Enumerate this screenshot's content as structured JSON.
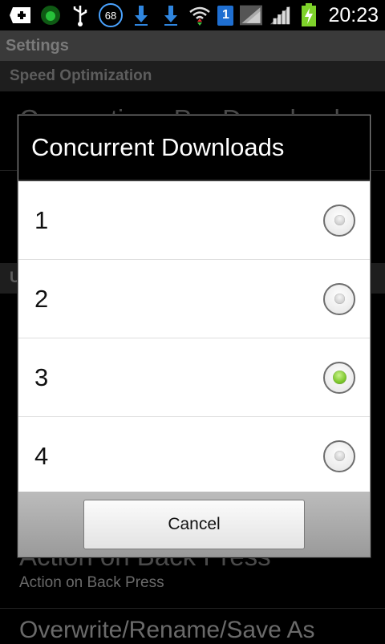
{
  "status_bar": {
    "badge_count": "68",
    "sim_slot": "1",
    "time": "20:23",
    "icons": [
      "add-icon",
      "android-icon",
      "usb-icon",
      "badge-68-icon",
      "download-icon",
      "download-icon",
      "wifi-icon",
      "sim-icon",
      "signal-icon",
      "signal-icon",
      "battery-charging-icon"
    ]
  },
  "screen": {
    "title": "Settings",
    "section_speed": "Speed Optimization",
    "item_connections": "Connections Per Download",
    "section_u_partial": "U",
    "item_back_press_title": "Action on Back Press",
    "item_back_press_summary": "Action on Back Press",
    "item_overwrite": "Overwrite/Rename/Save As"
  },
  "dialog": {
    "title": "Concurrent Downloads",
    "options": [
      {
        "label": "1",
        "checked": false
      },
      {
        "label": "2",
        "checked": false
      },
      {
        "label": "3",
        "checked": true
      },
      {
        "label": "4",
        "checked": false
      }
    ],
    "cancel_label": "Cancel"
  },
  "colors": {
    "radio_selected": "#7bc62a",
    "badge_ring": "#4aa3ff",
    "sim_blue": "#1f6fd1"
  }
}
